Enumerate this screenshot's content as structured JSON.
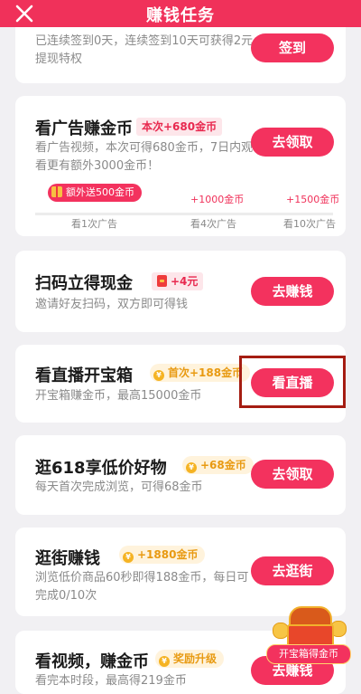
{
  "header": {
    "title": "赚钱任务",
    "close_icon": "close-icon"
  },
  "tasks": {
    "checkin": {
      "desc": "已连续签到0天，连续签到10天可获得2元提现特权",
      "button": "签到"
    },
    "ads": {
      "title": "看广告赚金币",
      "badge": "本次+680金币",
      "desc": "看广告视频，本次可得680金币，7日内观看更有额外3000金币！",
      "button": "去领取",
      "bonus_label": "额外送500金币",
      "milestones": [
        {
          "reward": "",
          "label": "看1次广告"
        },
        {
          "reward": "+1000金币",
          "label": "看4次广告"
        },
        {
          "reward": "+1500金币",
          "label": "看10次广告"
        }
      ]
    },
    "scan": {
      "title": "扫码立得现金",
      "badge": "+4元",
      "desc": "邀请好友扫码，双方即可得钱",
      "button": "去赚钱"
    },
    "live": {
      "title": "看直播开宝箱",
      "badge": "首次+188金币",
      "desc": "开宝箱赚金币，最高15000金币",
      "button": "看直播"
    },
    "shop618": {
      "title": "逛618享低价好物",
      "badge": "+68金币",
      "desc": "每天首次完成浏览，可得68金币",
      "button": "去领取"
    },
    "stroll": {
      "title": "逛街赚钱",
      "badge": "+1880金币",
      "desc": "浏览低价商品60秒即得188金币，每日可完成0/10次",
      "button": "去逛街"
    },
    "video": {
      "title": "看视频，赚金币",
      "badge": "奖励升级",
      "desc": "看完本时段，最高得219金币",
      "button": "去赚钱"
    }
  },
  "float_promo": {
    "label": "开宝箱得金币"
  },
  "colors": {
    "brand": "#f0315a",
    "button": "#f3325e",
    "gold": "#e89a12",
    "highlight": "#a51d12"
  }
}
